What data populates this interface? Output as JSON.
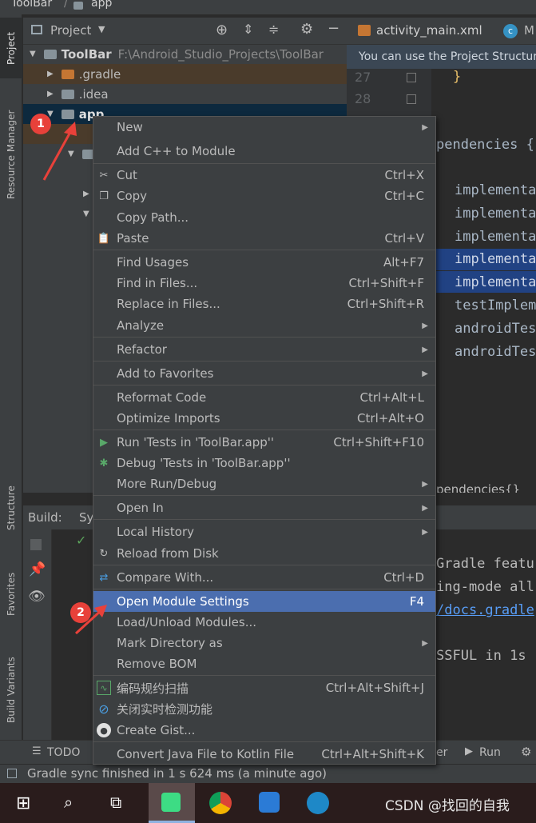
{
  "breadcrumb": {
    "project": "ToolBar",
    "sep": "/",
    "module": "app"
  },
  "left_strip": {
    "project_tab": "Project",
    "resource_tab": "Resource Manager",
    "structure_tab": "Structure",
    "favorites_tab": "Favorites",
    "build_variants_tab": "Build Variants"
  },
  "project_panel": {
    "title": "Project",
    "tree": [
      {
        "label": "ToolBar",
        "path": "F:\\Android_Studio_Projects\\ToolBar",
        "color": "#87939a"
      },
      {
        "label": ".gradle",
        "color": "#c57633"
      },
      {
        "label": ".idea",
        "color": "#87939a"
      },
      {
        "label": "app",
        "color": "#87939a"
      }
    ]
  },
  "editor": {
    "tabs": [
      {
        "label": "activity_main.xml"
      },
      {
        "label": "M"
      }
    ],
    "hint": "You can use the Project Structure",
    "line_numbers": [
      "27",
      "28"
    ],
    "code": [
      "}",
      "}",
      "pendencies {",
      "implementa",
      "implementa",
      "implementa",
      "implementa",
      "implementa",
      "testImplem",
      "androidTes",
      "androidTes"
    ],
    "breadcrumb": "pendencies{}"
  },
  "build": {
    "header": "Build:",
    "tab": "Sy",
    "console": [
      "Gradle featu",
      "ing-mode all",
      "/docs.gradle",
      "SSFUL in 1s"
    ]
  },
  "bottom_tools": {
    "todo": "TODO",
    "partial": "er",
    "run": "Run"
  },
  "status": {
    "message": "Gradle sync finished in 1 s 624 ms (a minute ago)"
  },
  "taskbar": {
    "watermark": "CSDN @找回的自我"
  },
  "annotations": {
    "badge1": "1",
    "badge2": "2"
  },
  "context_menu": {
    "items": [
      {
        "label": "New",
        "shortcut": "",
        "submenu": true,
        "icon": ""
      },
      {
        "label": "Add C++ to Module",
        "shortcut": "",
        "submenu": false,
        "icon": ""
      },
      {
        "label": "Cut",
        "shortcut": "Ctrl+X",
        "submenu": false,
        "icon": "scissors-icon"
      },
      {
        "label": "Copy",
        "shortcut": "Ctrl+C",
        "submenu": false,
        "icon": "copy-icon"
      },
      {
        "label": "Copy Path...",
        "shortcut": "",
        "submenu": false,
        "icon": ""
      },
      {
        "label": "Paste",
        "shortcut": "Ctrl+V",
        "submenu": false,
        "icon": "clipboard-icon"
      },
      {
        "label": "Find Usages",
        "shortcut": "Alt+F7",
        "submenu": false,
        "icon": ""
      },
      {
        "label": "Find in Files...",
        "shortcut": "Ctrl+Shift+F",
        "submenu": false,
        "icon": ""
      },
      {
        "label": "Replace in Files...",
        "shortcut": "Ctrl+Shift+R",
        "submenu": false,
        "icon": ""
      },
      {
        "label": "Analyze",
        "shortcut": "",
        "submenu": true,
        "icon": ""
      },
      {
        "label": "Refactor",
        "shortcut": "",
        "submenu": true,
        "icon": ""
      },
      {
        "label": "Add to Favorites",
        "shortcut": "",
        "submenu": true,
        "icon": ""
      },
      {
        "label": "Reformat Code",
        "shortcut": "Ctrl+Alt+L",
        "submenu": false,
        "icon": ""
      },
      {
        "label": "Optimize Imports",
        "shortcut": "Ctrl+Alt+O",
        "submenu": false,
        "icon": ""
      },
      {
        "label": "Run 'Tests in 'ToolBar.app''",
        "shortcut": "Ctrl+Shift+F10",
        "submenu": false,
        "icon": "run-icon"
      },
      {
        "label": "Debug 'Tests in 'ToolBar.app''",
        "shortcut": "",
        "submenu": false,
        "icon": "debug-icon"
      },
      {
        "label": "More Run/Debug",
        "shortcut": "",
        "submenu": true,
        "icon": ""
      },
      {
        "label": "Open In",
        "shortcut": "",
        "submenu": true,
        "icon": ""
      },
      {
        "label": "Local History",
        "shortcut": "",
        "submenu": true,
        "icon": ""
      },
      {
        "label": "Reload from Disk",
        "shortcut": "",
        "submenu": false,
        "icon": "reload-icon"
      },
      {
        "label": "Compare With...",
        "shortcut": "Ctrl+D",
        "submenu": false,
        "icon": "compare-icon"
      },
      {
        "label": "Open Module Settings",
        "shortcut": "F4",
        "submenu": false,
        "icon": "",
        "selected": true
      },
      {
        "label": "Load/Unload Modules...",
        "shortcut": "",
        "submenu": false,
        "icon": ""
      },
      {
        "label": "Mark Directory as",
        "shortcut": "",
        "submenu": true,
        "icon": ""
      },
      {
        "label": "Remove BOM",
        "shortcut": "",
        "submenu": false,
        "icon": ""
      },
      {
        "label": "编码规约扫描",
        "shortcut": "Ctrl+Alt+Shift+J",
        "submenu": false,
        "icon": "scan-icon"
      },
      {
        "label": "关闭实时检测功能",
        "shortcut": "",
        "submenu": false,
        "icon": "disable-icon"
      },
      {
        "label": "Create Gist...",
        "shortcut": "",
        "submenu": false,
        "icon": "github-icon"
      },
      {
        "label": "Convert Java File to Kotlin File",
        "shortcut": "Ctrl+Alt+Shift+K",
        "submenu": false,
        "icon": ""
      }
    ]
  }
}
